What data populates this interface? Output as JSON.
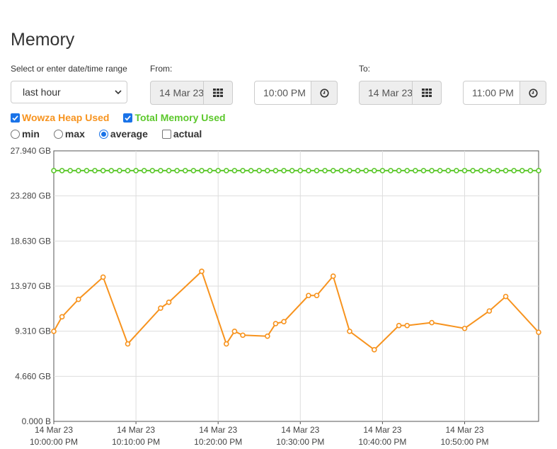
{
  "page": {
    "title": "Memory"
  },
  "range": {
    "label": "Select or enter date/time range",
    "selected": "last hour",
    "from_label": "From:",
    "to_label": "To:",
    "from_date": "14 Mar 23",
    "from_time": "10:00 PM",
    "to_date": "14 Mar 23",
    "to_time": "11:00 PM"
  },
  "series_toggles": [
    {
      "label": "Wowza Heap Used",
      "checked": true,
      "color": "#f7931e"
    },
    {
      "label": "Total Memory Used",
      "checked": true,
      "color": "#5cc82c"
    }
  ],
  "aggregation": {
    "options": [
      "min",
      "max",
      "average",
      "actual"
    ],
    "selected": "average",
    "actual_checked": false
  },
  "icons": {
    "date": "calendar-grid-icon",
    "time": "clock-icon",
    "select": "chevron-down-icon"
  },
  "chart_data": {
    "type": "line",
    "xlim": [
      0,
      59
    ],
    "ylim": [
      0,
      27.94
    ],
    "y_ticks": [
      "0.000 B",
      "4.660 GB",
      "9.310 GB",
      "13.970 GB",
      "18.630 GB",
      "23.280 GB",
      "27.940 GB"
    ],
    "x_ticks": [
      {
        "at": 0,
        "date": "14 Mar 23",
        "time": "10:00:00 PM"
      },
      {
        "at": 10,
        "date": "14 Mar 23",
        "time": "10:10:00 PM"
      },
      {
        "at": 20,
        "date": "14 Mar 23",
        "time": "10:20:00 PM"
      },
      {
        "at": 30,
        "date": "14 Mar 23",
        "time": "10:30:00 PM"
      },
      {
        "at": 40,
        "date": "14 Mar 23",
        "time": "10:40:00 PM"
      },
      {
        "at": 50,
        "date": "14 Mar 23",
        "time": "10:50:00 PM"
      }
    ],
    "grid": true,
    "series": [
      {
        "name": "Total Memory Used",
        "color": "#5cc82c",
        "points": [
          [
            0,
            25.9
          ],
          [
            1,
            25.9
          ],
          [
            2,
            25.9
          ],
          [
            3,
            25.9
          ],
          [
            4,
            25.9
          ],
          [
            5,
            25.9
          ],
          [
            6,
            25.9
          ],
          [
            7,
            25.9
          ],
          [
            8,
            25.9
          ],
          [
            9,
            25.9
          ],
          [
            10,
            25.9
          ],
          [
            11,
            25.9
          ],
          [
            12,
            25.9
          ],
          [
            13,
            25.9
          ],
          [
            14,
            25.9
          ],
          [
            15,
            25.9
          ],
          [
            16,
            25.9
          ],
          [
            17,
            25.9
          ],
          [
            18,
            25.9
          ],
          [
            19,
            25.9
          ],
          [
            20,
            25.9
          ],
          [
            21,
            25.9
          ],
          [
            22,
            25.9
          ],
          [
            23,
            25.9
          ],
          [
            24,
            25.9
          ],
          [
            25,
            25.9
          ],
          [
            26,
            25.9
          ],
          [
            27,
            25.9
          ],
          [
            28,
            25.9
          ],
          [
            29,
            25.9
          ],
          [
            30,
            25.9
          ],
          [
            31,
            25.9
          ],
          [
            32,
            25.9
          ],
          [
            33,
            25.9
          ],
          [
            34,
            25.9
          ],
          [
            35,
            25.9
          ],
          [
            36,
            25.9
          ],
          [
            37,
            25.9
          ],
          [
            38,
            25.9
          ],
          [
            39,
            25.9
          ],
          [
            40,
            25.9
          ],
          [
            41,
            25.9
          ],
          [
            42,
            25.9
          ],
          [
            43,
            25.9
          ],
          [
            44,
            25.9
          ],
          [
            45,
            25.9
          ],
          [
            46,
            25.9
          ],
          [
            47,
            25.9
          ],
          [
            48,
            25.9
          ],
          [
            49,
            25.9
          ],
          [
            50,
            25.9
          ],
          [
            51,
            25.9
          ],
          [
            52,
            25.9
          ],
          [
            53,
            25.9
          ],
          [
            54,
            25.9
          ],
          [
            55,
            25.9
          ],
          [
            56,
            25.9
          ],
          [
            57,
            25.9
          ],
          [
            58,
            25.9
          ],
          [
            59,
            25.9
          ]
        ]
      },
      {
        "name": "Wowza Heap Used",
        "color": "#f7931e",
        "points": [
          [
            0,
            9.3
          ],
          [
            1,
            10.8
          ],
          [
            3,
            12.6
          ],
          [
            6,
            14.9
          ],
          [
            9,
            8.0
          ],
          [
            13,
            11.7
          ],
          [
            14,
            12.3
          ],
          [
            18,
            15.5
          ],
          [
            21,
            8.0
          ],
          [
            22,
            9.3
          ],
          [
            23,
            8.9
          ],
          [
            26,
            8.8
          ],
          [
            27,
            10.1
          ],
          [
            28,
            10.3
          ],
          [
            31,
            13.0
          ],
          [
            32,
            13.0
          ],
          [
            34,
            15.0
          ],
          [
            36,
            9.3
          ],
          [
            39,
            7.4
          ],
          [
            42,
            9.9
          ],
          [
            43,
            9.9
          ],
          [
            46,
            10.2
          ],
          [
            50,
            9.6
          ],
          [
            53,
            11.4
          ],
          [
            55,
            12.9
          ],
          [
            59,
            9.2
          ]
        ]
      }
    ]
  }
}
